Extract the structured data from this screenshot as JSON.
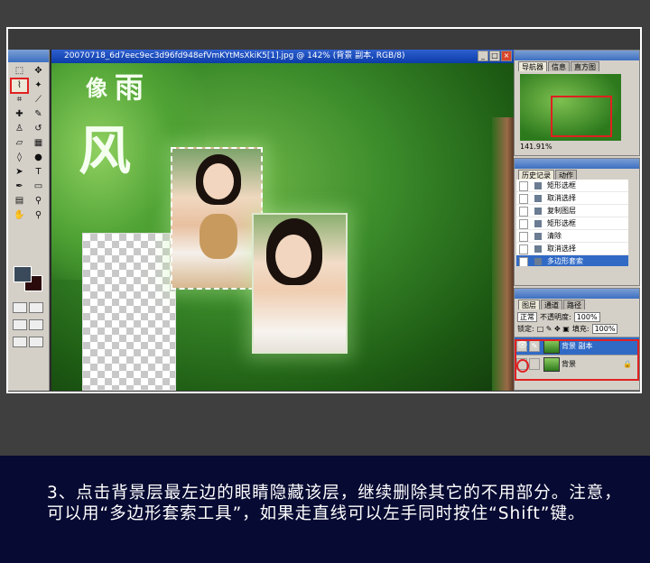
{
  "document": {
    "title": "20070718_6d7eec9ec3d96fd948efVmKYtMsXkiK5[1].jpg @ 142% (背景 副本, RGB/8)",
    "calligraphy": [
      "像",
      "雨",
      "风"
    ]
  },
  "navigator": {
    "tabs": [
      "导航器",
      "信息",
      "直方图"
    ],
    "zoom": "141.91%"
  },
  "history": {
    "tabs": [
      "历史记录",
      "动作"
    ],
    "items": [
      "矩形选框",
      "取消选择",
      "复制图层",
      "矩形选框",
      "清除",
      "取消选择",
      "多边形套索"
    ],
    "selected_index": 6
  },
  "layers": {
    "tabs": [
      "图层",
      "通道",
      "路径"
    ],
    "blend_mode": "正常",
    "opacity_label": "不透明度:",
    "opacity": "100%",
    "lock_label": "锁定:",
    "fill_label": "填充:",
    "fill": "100%",
    "rows": [
      {
        "name": "背景 副本",
        "visible": true,
        "selected": true
      },
      {
        "name": "背景",
        "visible": false,
        "selected": false,
        "locked": true
      }
    ]
  },
  "caption": {
    "text": "3、点击背景层最左边的眼睛隐藏该层，继续删除其它的不用部分。注意，可以用“多边形套索工具”，如果走直线可以左手同时按住“Shift”键。"
  },
  "colors": {
    "highlight": "#e02020",
    "caption_bg": "#070a32",
    "selection": "#316ac5"
  }
}
